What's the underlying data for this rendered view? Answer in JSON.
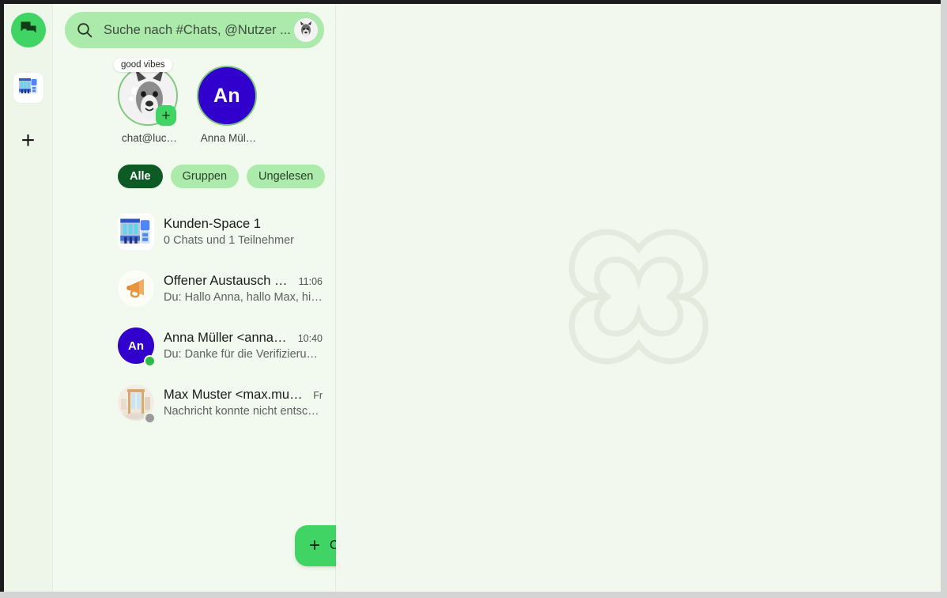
{
  "app": {
    "accent_green": "#3fd463",
    "chip_green": "#acebab",
    "chip_active_green": "#0d5a24",
    "panel_bg": "#f2f9ee",
    "avatar_purple": "#3200cc"
  },
  "rail": {
    "items": [
      {
        "name": "chats",
        "icon": "chat-bubbles-icon",
        "label": "Chats"
      },
      {
        "name": "space",
        "icon": "storefront-icon",
        "label": "Kunden-Space 1"
      },
      {
        "name": "add",
        "icon": "plus-icon",
        "label": "+"
      }
    ],
    "plus_glyph": "+"
  },
  "search": {
    "placeholder": "Suche nach #Chats, @Nutzer ...",
    "icon": "search-icon",
    "avatar": "profile-avatar-dog"
  },
  "stories": {
    "items": [
      {
        "label": "chat@luc…",
        "type": "photo",
        "photo": "dog-photo",
        "tooltip": "good vibes",
        "badge": "+",
        "has_badge": true
      },
      {
        "label": "Anna Mül…",
        "type": "initials",
        "initials": "An",
        "has_badge": false
      }
    ]
  },
  "filters": {
    "chips": [
      {
        "label": "Alle",
        "active": true
      },
      {
        "label": "Gruppen",
        "active": false
      },
      {
        "label": "Ungelesen",
        "active": false
      }
    ]
  },
  "conversations": [
    {
      "title": "Kunden-Space 1",
      "subtitle": "0 Chats und 1 Teilnehmer",
      "time": "",
      "avatar_type": "storefront-icon",
      "presence": ""
    },
    {
      "title": "Offener Austausch für alle",
      "subtitle": "Du: Hallo Anna, hallo Max, hier können…",
      "time": "11:06",
      "avatar_type": "megaphone-icon",
      "presence": ""
    },
    {
      "title": "Anna Müller <anna.mueller@…",
      "subtitle": "Du: Danke für die Verifizierung, hat alle…",
      "time": "10:40",
      "avatar_type": "initials",
      "initials": "An",
      "presence": "online"
    },
    {
      "title": "Max Muster <max.muster@luck…",
      "subtitle": "Nachricht konnte nicht entschlüsselt …",
      "time": "Fr",
      "avatar_type": "room-photo",
      "presence": "offline"
    }
  ],
  "fab": {
    "label": "Chat",
    "plus_glyph": "+"
  },
  "main": {
    "watermark": "clover-knot-logo"
  }
}
